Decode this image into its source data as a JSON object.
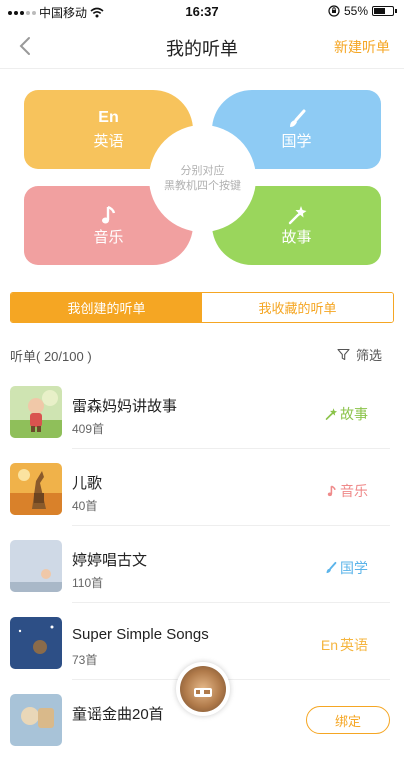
{
  "status_bar": {
    "carrier": "中国移动",
    "time": "16:37",
    "battery_text": "55%",
    "battery_level": 0.55
  },
  "nav": {
    "title": "我的听单",
    "right_action": "新建听单",
    "accent_color": "#f5a623"
  },
  "categories": {
    "center_note_line1": "分别对应",
    "center_note_line2": "黑教机四个按键",
    "items": [
      {
        "glyph": "En",
        "label": "英语",
        "color": "#f7c35c",
        "icon": "en-text-icon"
      },
      {
        "glyph": "",
        "label": "国学",
        "color": "#8ecbf4",
        "icon": "brush-icon"
      },
      {
        "glyph": "",
        "label": "音乐",
        "color": "#f1a0a0",
        "icon": "music-note-icon"
      },
      {
        "glyph": "",
        "label": "故事",
        "color": "#9ad65c",
        "icon": "magic-wand-icon"
      }
    ]
  },
  "tabs": [
    {
      "label": "我创建的听单",
      "active": true
    },
    {
      "label": "我收藏的听单",
      "active": false
    }
  ],
  "list_header": {
    "count": "听单( 20/100 )",
    "filter_label": "筛选"
  },
  "playlists": [
    {
      "title": "雷森妈妈讲故事",
      "count": "409首",
      "tag_glyph": "",
      "tag": "故事",
      "tag_color": "#8bc34a",
      "tag_icon": "magic-wand-icon"
    },
    {
      "title": "儿歌",
      "count": "40首",
      "tag_glyph": "",
      "tag": "音乐",
      "tag_color": "#ef8a8a",
      "tag_icon": "music-note-icon"
    },
    {
      "title": "婷婷唱古文",
      "count": "110首",
      "tag_glyph": "",
      "tag": "国学",
      "tag_color": "#5bb4ea",
      "tag_icon": "brush-icon"
    },
    {
      "title": "Super Simple Songs",
      "count": "73首",
      "tag_glyph": "En",
      "tag": "英语",
      "tag_color": "#f5b53f",
      "tag_icon": "en-text-icon"
    },
    {
      "title": "童谣金曲20首",
      "count": "",
      "tag_glyph": "",
      "tag": "",
      "tag_color": "#f5a623",
      "tag_icon": ""
    }
  ],
  "bind_button": "绑定"
}
